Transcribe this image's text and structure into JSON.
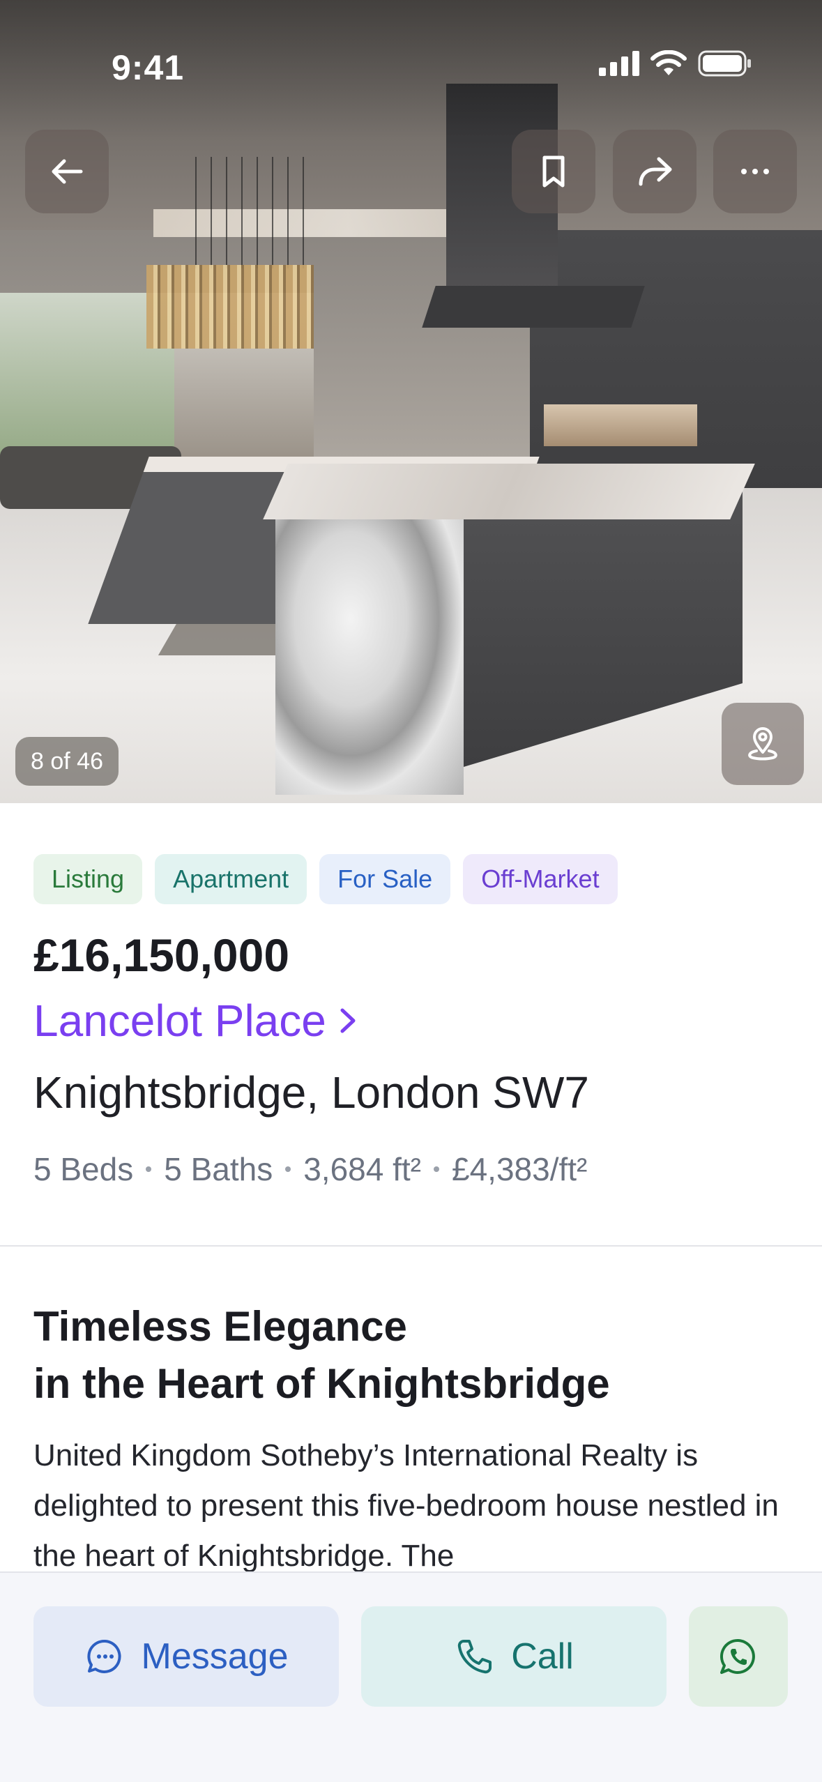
{
  "status_bar": {
    "time": "9:41"
  },
  "gallery": {
    "counter": "8 of 46"
  },
  "tags": [
    "Listing",
    "Apartment",
    "For Sale",
    "Off-Market"
  ],
  "listing": {
    "price": "£16,150,000",
    "street": "Lancelot Place",
    "area": "Knightsbridge, London SW7",
    "specs": [
      "5 Beds",
      "5 Baths",
      "3,684 ft²",
      "£4,383/ft²"
    ],
    "headline_line1": "Timeless Elegance",
    "headline_line2": "in the Heart of Knightsbridge",
    "description": "United Kingdom Sotheby’s International Realty is delighted to present this five-bedroom house nestled in the heart of Knightsbridge. The"
  },
  "actions": {
    "message_label": "Message",
    "call_label": "Call"
  },
  "icons": {
    "back": "arrow-left-icon",
    "bookmark": "bookmark-icon",
    "share": "share-icon",
    "more": "more-icon",
    "map": "map-pin-icon",
    "message": "chat-bubble-icon",
    "call": "phone-icon",
    "whatsapp": "whatsapp-icon"
  },
  "colors": {
    "accent_purple": "#7a3ff0",
    "message_blue": "#2c5fc2",
    "call_teal": "#16736e",
    "whatsapp_green": "#1a7a3a"
  }
}
